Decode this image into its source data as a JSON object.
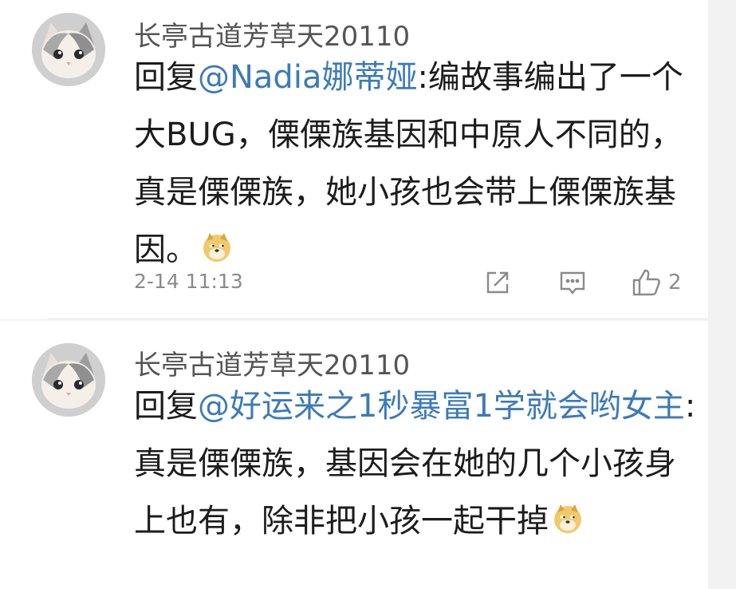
{
  "comments": [
    {
      "author": "长亭古道芳草天20110",
      "reply_prefix": "回复",
      "mention": "@Nadia娜蒂娅",
      "text": ":编故事编出了一个大BUG，傈傈族基因和中原人不同的，真是傈傈族，她小孩也会带上傈傈族基因。",
      "emoji": "doge-emoji",
      "timestamp": "2-14 11:13",
      "likes": "2",
      "actions": [
        "share-icon",
        "comment-icon",
        "like-icon"
      ]
    },
    {
      "author": "长亭古道芳草天20110",
      "reply_prefix": "回复",
      "mention": "@好运来之1秒暴富1学就会哟女主",
      "text": ":真是傈傈族，基因会在她的几个小孩身上也有，除非把小孩一起干掉",
      "emoji": "doge-emoji"
    }
  ]
}
